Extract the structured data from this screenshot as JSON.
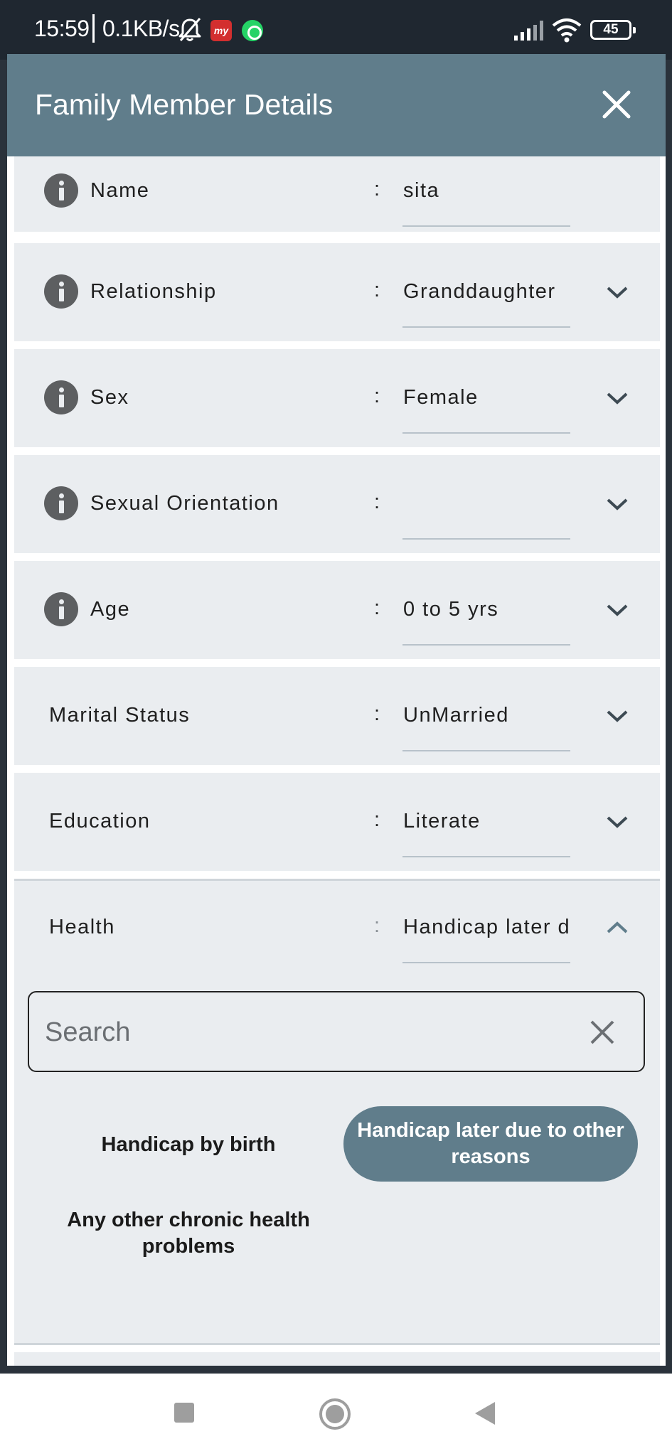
{
  "status_bar": {
    "time": "15:59",
    "speed": "0.1KB/s",
    "battery": "45",
    "app_badge": "my"
  },
  "dialog": {
    "title": "Family Member Details"
  },
  "fields": [
    {
      "label": "Name",
      "value": "sita",
      "has_info": true,
      "control": "text"
    },
    {
      "label": "Relationship",
      "value": "Granddaughter",
      "has_info": true,
      "control": "dropdown"
    },
    {
      "label": "Sex",
      "value": "Female",
      "has_info": true,
      "control": "dropdown"
    },
    {
      "label": "Sexual Orientation",
      "value": "",
      "has_info": true,
      "control": "dropdown"
    },
    {
      "label": "Age",
      "value": "0 to 5 yrs",
      "has_info": true,
      "control": "dropdown"
    },
    {
      "label": "Marital Status",
      "value": "UnMarried",
      "has_info": false,
      "control": "dropdown"
    },
    {
      "label": "Education",
      "value": "Literate",
      "has_info": false,
      "control": "dropdown"
    },
    {
      "label": "Health",
      "value": "Handicap later due to other reasons",
      "has_info": false,
      "control": "dropdown-open"
    }
  ],
  "colon": ":",
  "health_dropdown": {
    "search_placeholder": "Search",
    "options": [
      {
        "label": "Handicap by birth",
        "selected": false
      },
      {
        "label": "Handicap later due to other reasons",
        "selected": true
      },
      {
        "label": "Any other chronic health problems",
        "selected": false
      }
    ]
  },
  "colors": {
    "header": "#607d8b",
    "row_bg": "#eaedf0",
    "selected_chip": "#607d8b",
    "status_bar": "#1f2730"
  },
  "icons": [
    "bell-off-icon",
    "whatsapp-icon",
    "signal-icon",
    "wifi-icon",
    "battery-icon",
    "close-icon",
    "info-icon",
    "chevron-down-icon",
    "chevron-up-icon",
    "clear-icon",
    "nav-recents-icon",
    "nav-home-icon",
    "nav-back-icon"
  ]
}
